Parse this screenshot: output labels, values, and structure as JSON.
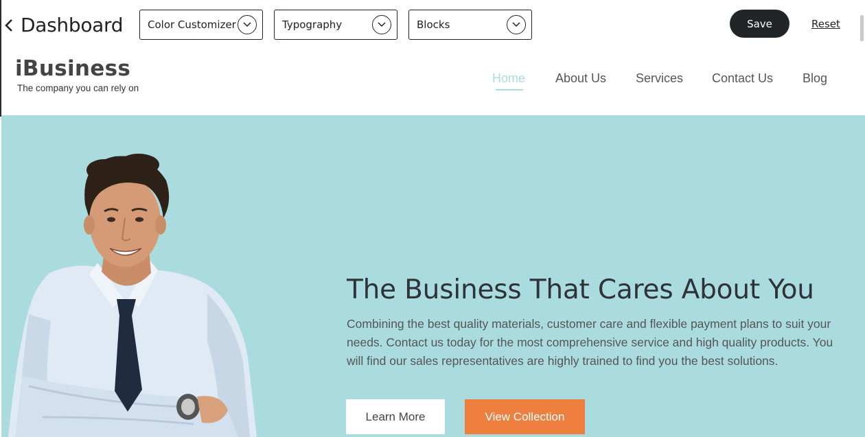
{
  "editor": {
    "back_label": "Dashboard",
    "dropdowns": [
      {
        "label": "Color Customizer"
      },
      {
        "label": "Typography"
      },
      {
        "label": "Blocks"
      }
    ],
    "save_label": "Save",
    "reset_label": "Reset"
  },
  "site": {
    "logo": "iBusiness",
    "tagline": "The company you can rely on",
    "nav": [
      {
        "label": "Home",
        "active": true
      },
      {
        "label": "About Us"
      },
      {
        "label": "Services"
      },
      {
        "label": "Contact Us"
      },
      {
        "label": "Blog"
      }
    ]
  },
  "hero": {
    "title": "The Business That Cares About You",
    "text": "Combining the best quality materials, customer care and flexible payment plans to suit your needs. Contact us today for the most comprehensive service and high quality products. You will find our sales representatives are highly trained to find you the best solutions.",
    "primary_button": "Learn More",
    "secondary_button": "View Collection",
    "image_alt": "Smiling businessman with crossed arms"
  },
  "colors": {
    "hero_bg": "#aadbdf",
    "accent_orange": "#ef7f3f",
    "nav_active": "#a8dde0",
    "save_bg": "#222528"
  }
}
